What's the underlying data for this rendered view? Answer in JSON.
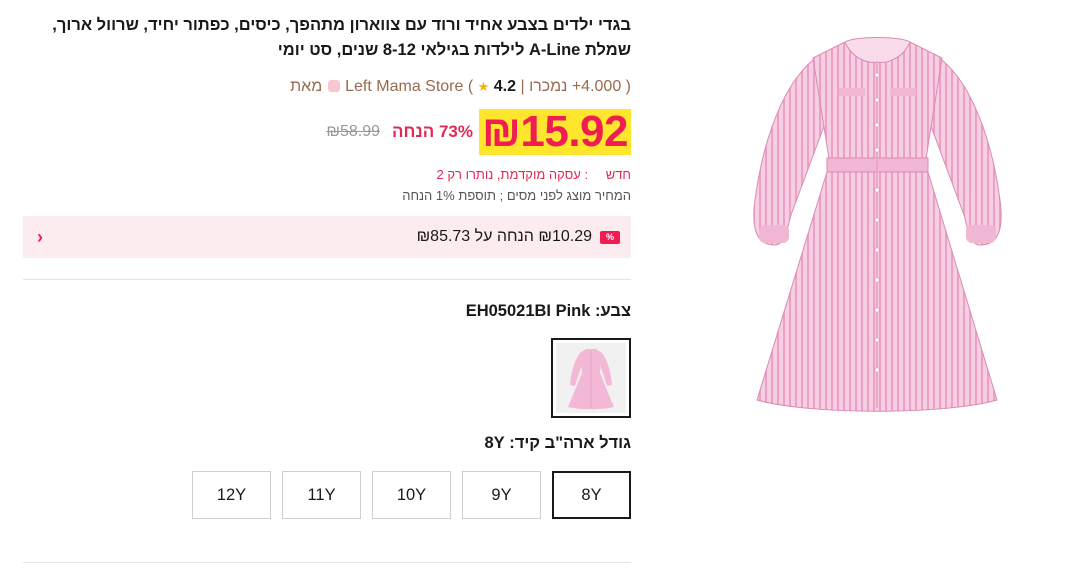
{
  "product": {
    "title": "בגדי ילדים בצבע אחיד ורוד עם צווארון מתהפך, כיסים, כפתור יחיד, שרוול ארוך, שמלת A-Line לילדות בגילאי 8-12 שנים, סט יומי",
    "image_alt": "pink striped dress"
  },
  "store": {
    "from_label": "מאת",
    "name": "Left Mama Store",
    "rating": "4.2",
    "sold": "4.000+ נמכרו"
  },
  "price": {
    "current": "₪15.92",
    "discount": "73% הנחה",
    "original": "₪58.99",
    "new_label": "חדש",
    "deal_text": "עסקה מוקדמת, נותרו רק 2",
    "tax_note": "המחיר מוצג לפני מסים ; תוספת 1% הנחה"
  },
  "coupon": {
    "badge": "%",
    "text": "₪10.29 הנחה על ₪85.73"
  },
  "color": {
    "label": "צבע:",
    "value": "EH05021BI Pink"
  },
  "size": {
    "label": "גודל ארה\"ב קיד:",
    "selected": "8Y",
    "options": [
      "8Y",
      "9Y",
      "10Y",
      "11Y",
      "12Y"
    ]
  },
  "colors": {
    "accent": "#ee1d52",
    "price_highlight": "#ffe52c",
    "coupon_bg": "#fdecef",
    "dress_pink": "#f3b8d6"
  }
}
